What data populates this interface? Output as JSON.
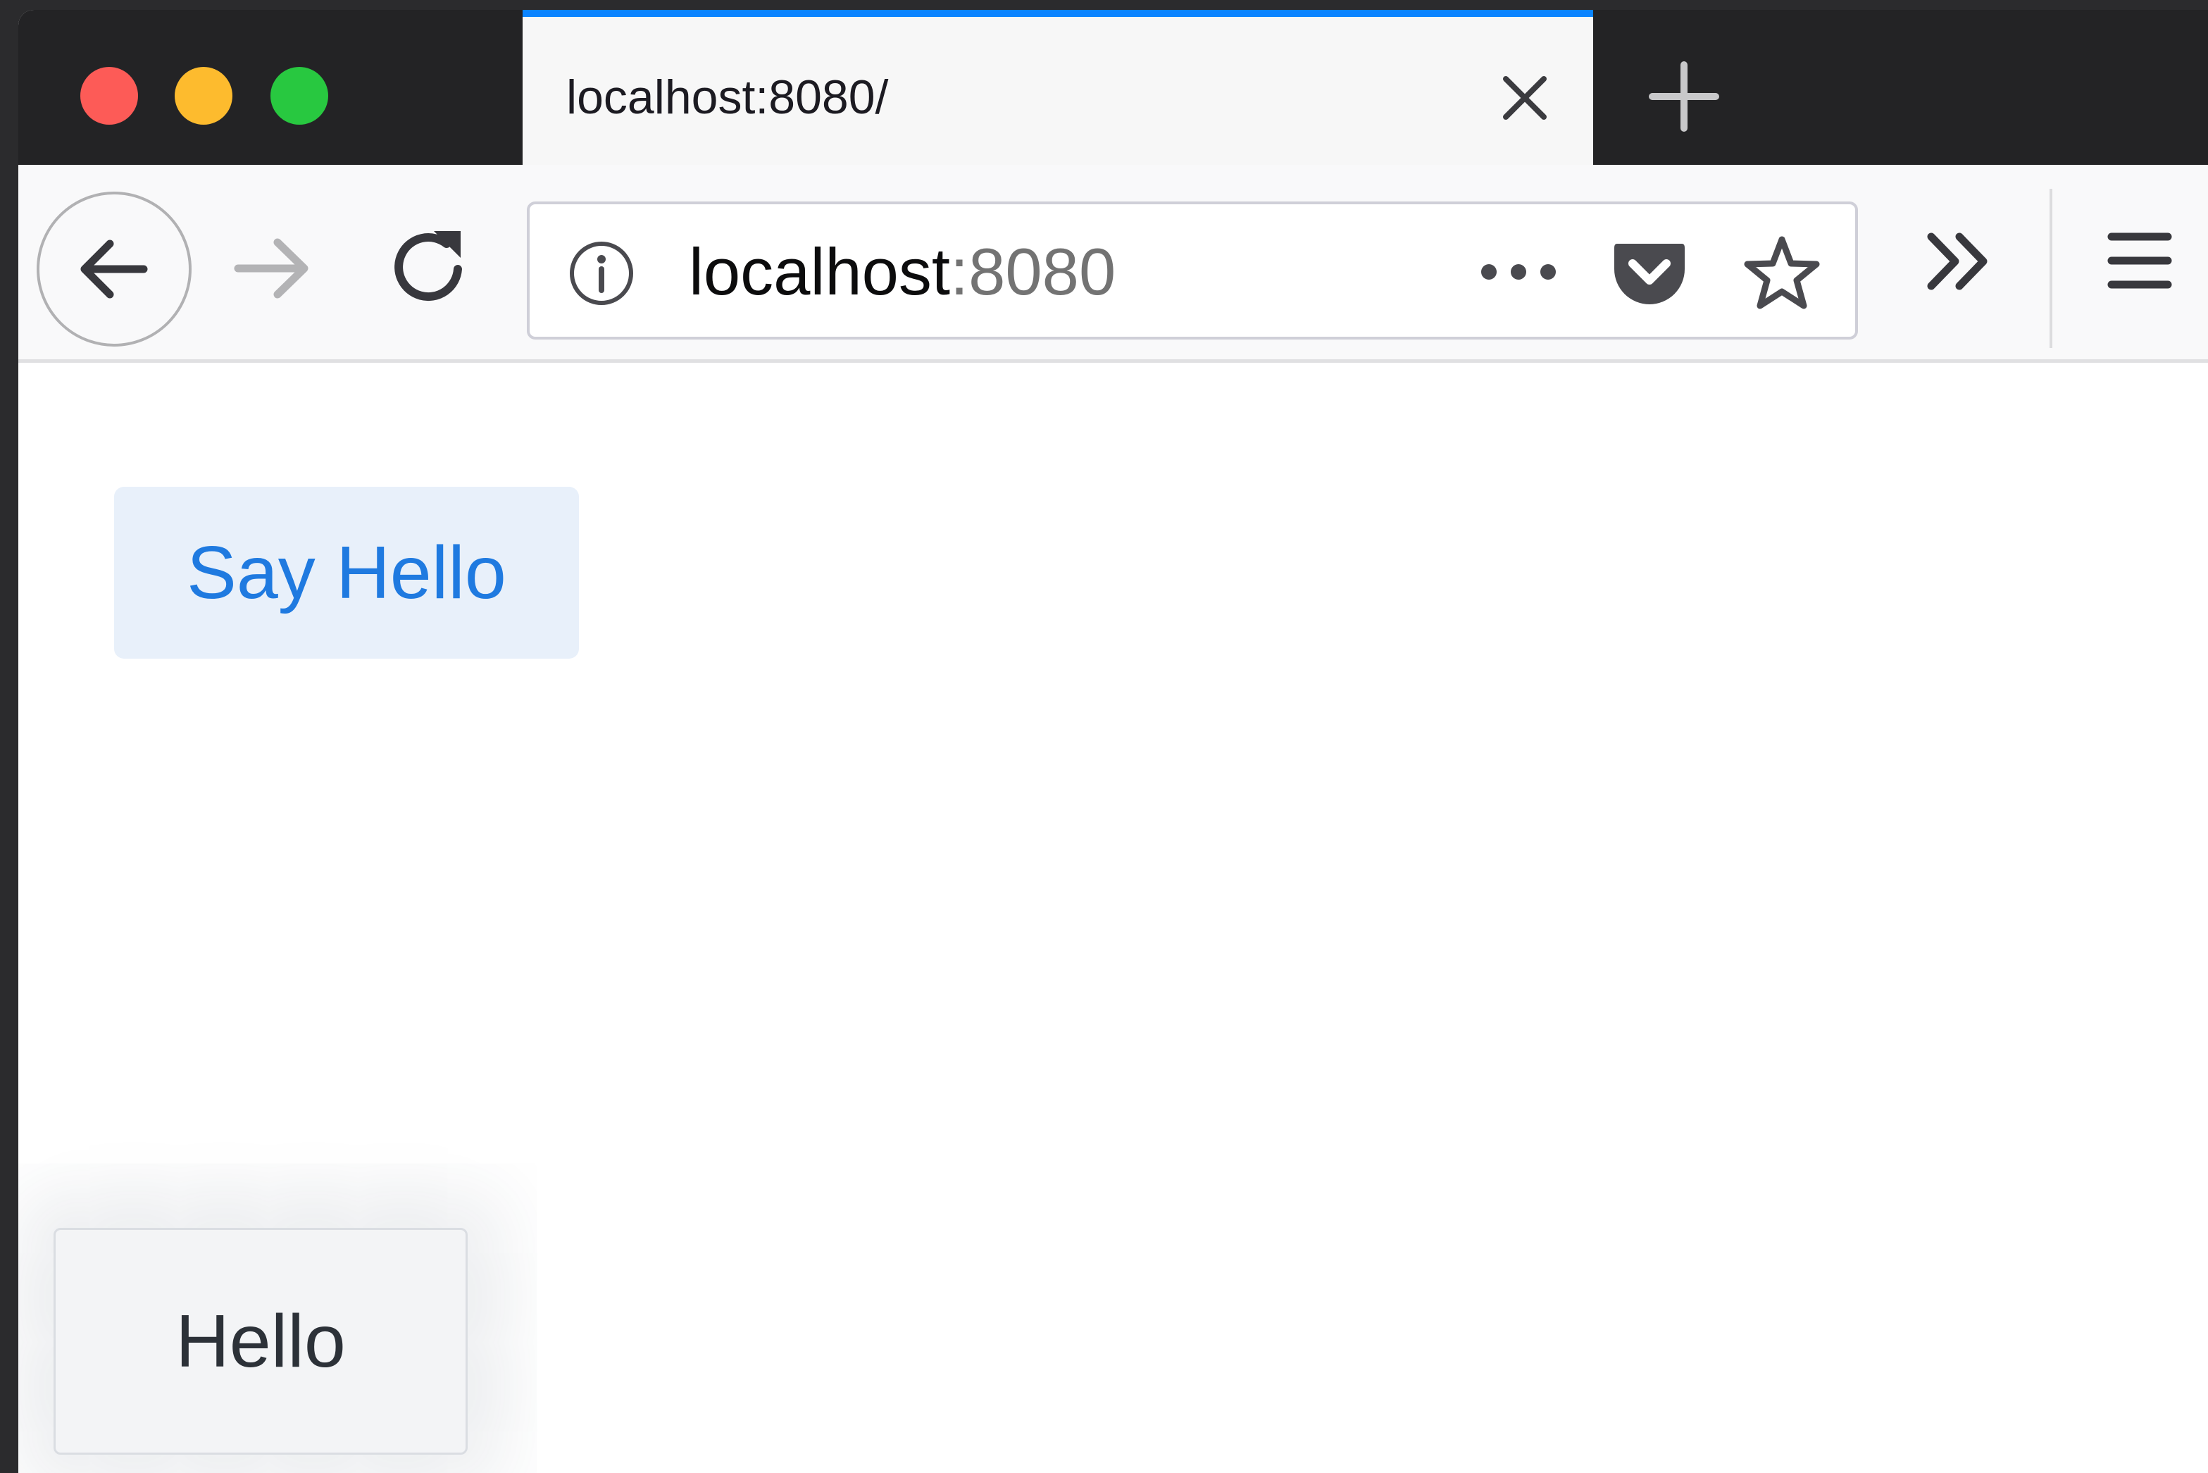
{
  "window": {
    "controls": [
      "close",
      "minimize",
      "zoom"
    ]
  },
  "tab": {
    "title": "localhost:8080/",
    "accent_color": "#0a84ff"
  },
  "toolbar": {
    "url_host": "localhost",
    "url_port": ":8080",
    "icons": [
      "back-arrow-icon",
      "forward-arrow-icon",
      "reload-icon",
      "info-icon",
      "more-dots-icon",
      "pocket-icon",
      "star-icon",
      "double-chevron-icon",
      "hamburger-menu-icon"
    ]
  },
  "page": {
    "button_label": "Say Hello",
    "button_color": "#1f7ae0",
    "toast_text": "Hello"
  }
}
